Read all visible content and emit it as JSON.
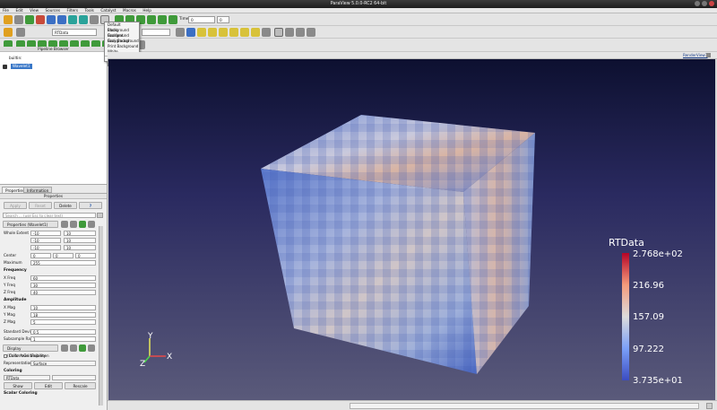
{
  "window": {
    "title": "ParaView 5.0.0-RC2 64-bit"
  },
  "menu": [
    "File",
    "Edit",
    "View",
    "Sources",
    "Filters",
    "Tools",
    "Catalyst",
    "Macros",
    "Help"
  ],
  "toolbar": {
    "time_label": "Time:",
    "time_value": "0",
    "time_index": "0",
    "array_select": "RTData",
    "representation_select": ""
  },
  "background_menu": {
    "items": [
      "Default Background",
      "Black Background",
      "Gradient Background",
      "Gray Background",
      "Print Background",
      "White Background"
    ],
    "edit_palette": "Edit Current Palette ..."
  },
  "pipeline": {
    "header": "Pipeline Browser",
    "builtin": "builtin:",
    "source": "Wavelet1"
  },
  "tabs": {
    "properties": "Properties",
    "information": "Information"
  },
  "properties": {
    "header": "Properties",
    "apply": "Apply",
    "reset": "Reset",
    "delete": "Delete",
    "help": "?",
    "search_placeholder": "Search ... (use Esc to clear text)",
    "section_title": "Properties (Wavelet1)",
    "whole_extent_label": "Whole Extent",
    "whole_extent": [
      "-10",
      "10",
      "-10",
      "10",
      "-10",
      "10"
    ],
    "center_label": "Center",
    "center": [
      "0",
      "0",
      "0"
    ],
    "maximum_label": "Maximum",
    "maximum": "255",
    "frequency_title": "Frequency",
    "x_freq_label": "X Freq",
    "x_freq": "60",
    "y_freq_label": "Y Freq",
    "y_freq": "30",
    "z_freq_label": "Z Freq",
    "z_freq": "40",
    "amplitude_title": "Amplitude",
    "x_mag_label": "X Mag",
    "x_mag": "10",
    "y_mag_label": "Y Mag",
    "y_mag": "18",
    "z_mag_label": "Z Mag",
    "z_mag": "5",
    "std_dev_label": "Standard Deviation",
    "std_dev": "0.5",
    "subsample_label": "Subsample Rate",
    "subsample": "1",
    "display_title": "Display (UniformGridRepresen",
    "color_axes_label": "Color Axes Visibility",
    "representation_label": "Representation",
    "representation": "Surface",
    "coloring_title": "Coloring",
    "coloring_array": "RTData",
    "coloring_component": "",
    "show_label": "Show",
    "edit_label": "Edit",
    "rescale_label": "Rescale",
    "scalar_coloring_title": "Scalar Coloring"
  },
  "view": {
    "tab_label": "RenderView1"
  },
  "legend": {
    "title": "RTData",
    "labels": [
      "2.768e+02",
      "216.96",
      "157.09",
      "97.222",
      "3.735e+01"
    ],
    "max": 276.8,
    "min": 37.35
  },
  "axes": {
    "x": "X",
    "y": "Y",
    "z": "Z"
  },
  "colors": {
    "accent_selection": "#3a78c8",
    "cold": "#3b4cc0",
    "hot": "#b40426"
  }
}
